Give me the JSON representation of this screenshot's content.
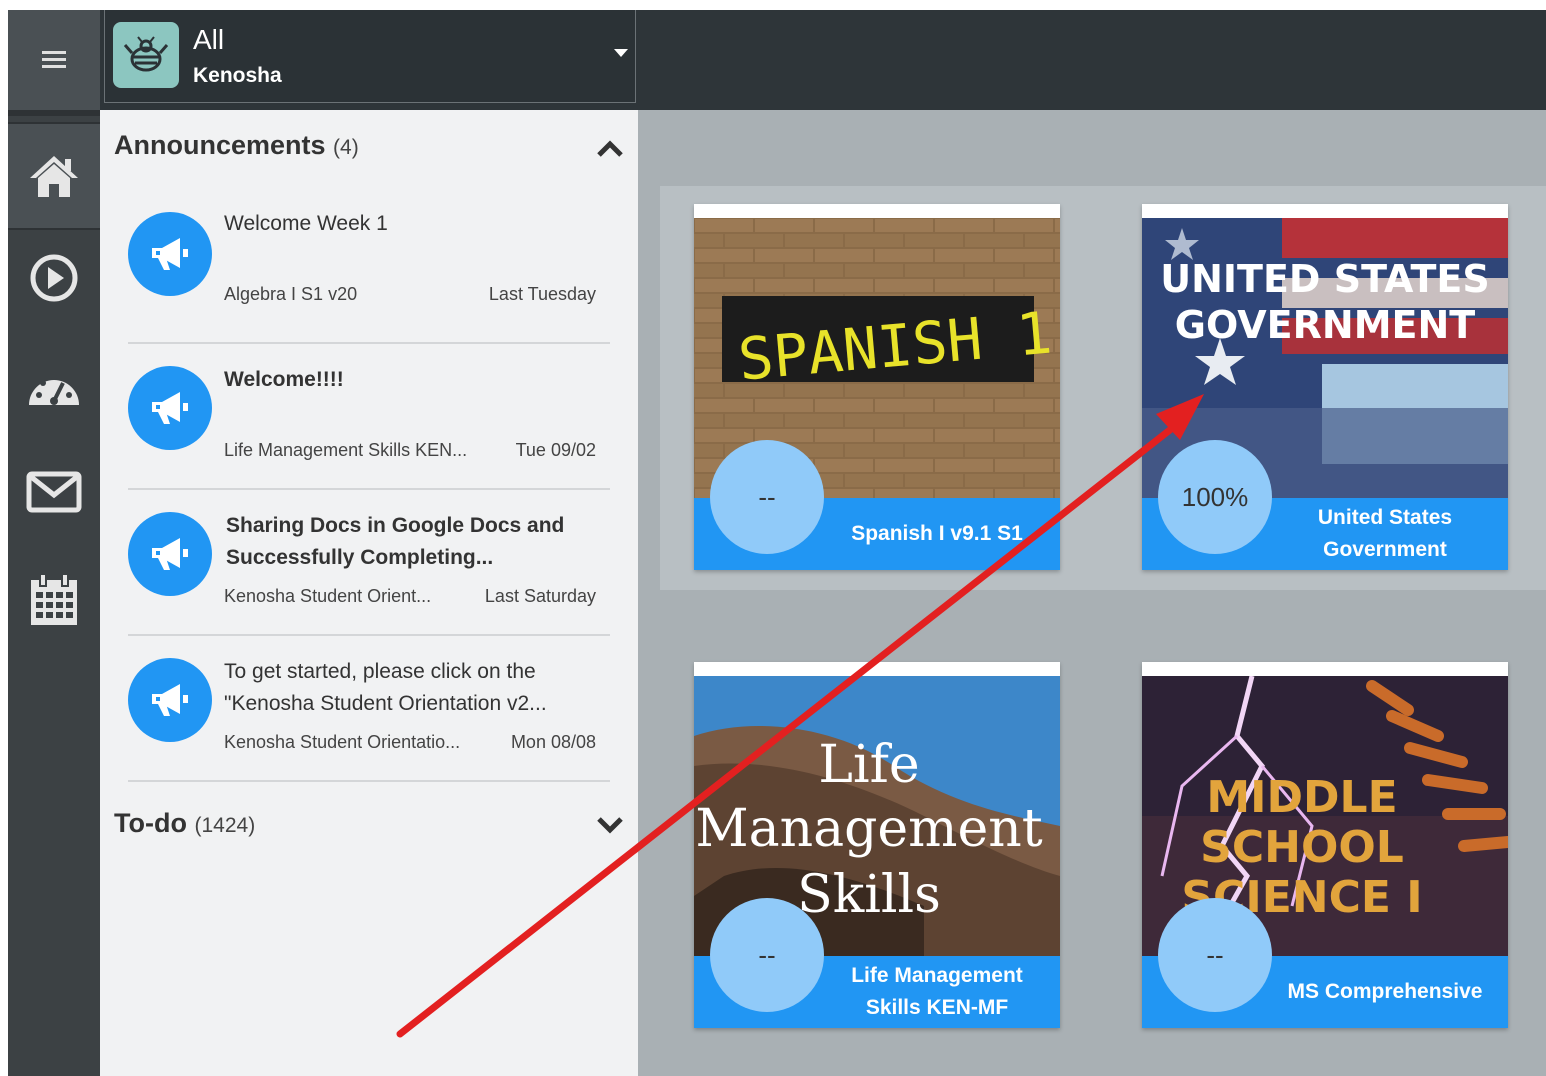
{
  "topbar": {
    "org_title": "All",
    "org_subtitle": "Kenosha"
  },
  "rail": {
    "icons": [
      "menu-icon",
      "home-icon",
      "play-circle-icon",
      "dashboard-gauge-icon",
      "mail-icon",
      "calendar-icon"
    ]
  },
  "announcements": {
    "label": "Announcements",
    "count": "(4)",
    "items": [
      {
        "title": "Welcome Week 1",
        "course": "Algebra I S1 v20",
        "date": "Last Tuesday"
      },
      {
        "title": "Welcome!!!!",
        "course": "Life Management Skills KEN...",
        "date": "Tue 09/02"
      },
      {
        "title": "Sharing Docs in Google Docs and Successfully Completing...",
        "course": "Kenosha Student Orient...",
        "date": "Last Saturday"
      },
      {
        "title": "To get started, please click on the \"Kenosha Student Orientation v2...",
        "course": "Kenosha Student Orientatio...",
        "date": "Mon 08/08"
      }
    ]
  },
  "todo": {
    "label": "To-do",
    "count": "(1424)"
  },
  "courses": [
    {
      "name": "Spanish I v9.1 S1",
      "progress": "--",
      "image_text": "SPANISH 1"
    },
    {
      "name": "United States Government",
      "progress": "100%",
      "image_text": "UNITED STATES GOVERNMENT"
    },
    {
      "name": "Life Management Skills KEN-MF",
      "progress": "--",
      "image_text": "Life Management Skills"
    },
    {
      "name": "MS Comprehensive",
      "progress": "--",
      "image_text": "MIDDLE SCHOOL SCIENCE I"
    }
  ],
  "colors": {
    "accent": "#2196f3",
    "rail": "#3c4144",
    "annotation_arrow": "#e32020"
  }
}
